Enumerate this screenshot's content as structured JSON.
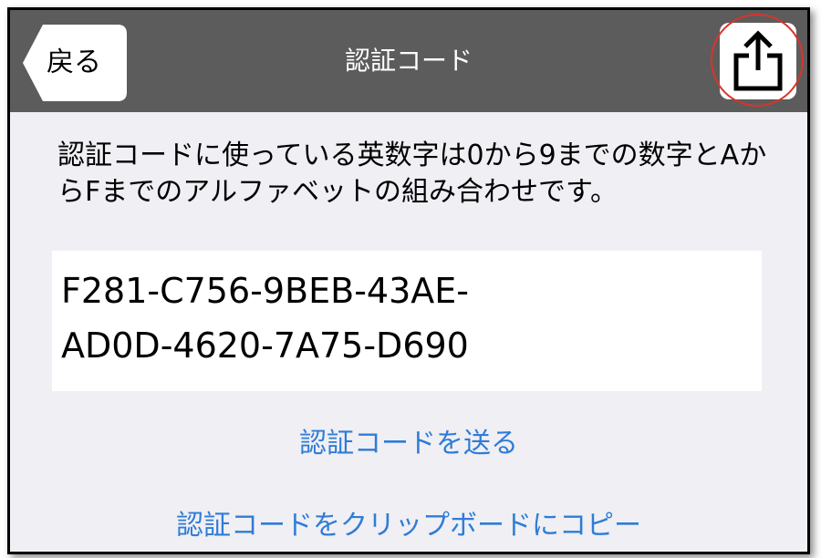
{
  "colors": {
    "navbar_background": "#5c5c5c",
    "content_background": "#efeff4",
    "link_color": "#2f7cd6",
    "highlight_ring": "#d9342b"
  },
  "navbar": {
    "back_label": "戻る",
    "title": "認証コード",
    "share_icon": "share-icon"
  },
  "content": {
    "description": "認証コードに使っている英数字は0から9までの数字とAからFまでのアルファベットの組み合わせです。",
    "code_line_1": "F281-C756-9BEB-43AE-",
    "code_line_2": "AD0D-4620-7A75-D690"
  },
  "actions": {
    "send_label": "認証コードを送る",
    "copy_label": "認証コードをクリップボードにコピー"
  }
}
